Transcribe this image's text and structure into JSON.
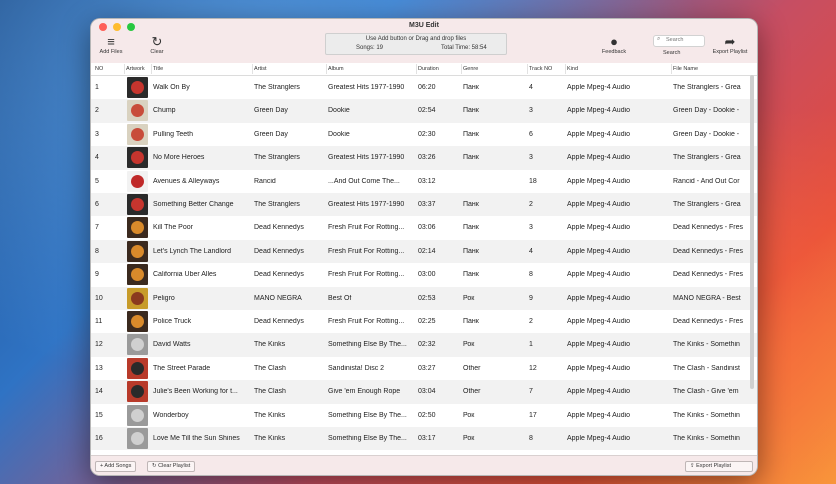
{
  "window": {
    "title": "M3U Edit"
  },
  "toolbar": {
    "add_files": "Add Files",
    "clear": "Clear",
    "drop_message": "Use Add button or Drag and drop files",
    "songs": "Songs: 19",
    "total_time": "Total Time: 58:54",
    "feedback": "Feedback",
    "search_placeholder": "Search",
    "search_label": "Search",
    "export": "Export Playlist"
  },
  "columns": [
    "NO",
    "Artwork",
    "Title",
    "Artist",
    "Album",
    "Duration",
    "Genre",
    "Track NO",
    "Kind",
    "File Name"
  ],
  "rows": [
    {
      "no": "1",
      "title": "Walk On By",
      "artist": "The Stranglers",
      "album": "Greatest Hits 1977-1990",
      "duration": "06:20",
      "genre": "Панк",
      "track": "4",
      "kind": "Apple Mpeg-4 Audio",
      "file": "The Stranglers - Grea"
    },
    {
      "no": "2",
      "title": "Chump",
      "artist": "Green Day",
      "album": "Dookie",
      "duration": "02:54",
      "genre": "Панк",
      "track": "3",
      "kind": "Apple Mpeg-4 Audio",
      "file": "Green Day - Dookie -"
    },
    {
      "no": "3",
      "title": "Pulling Teeth",
      "artist": "Green Day",
      "album": "Dookie",
      "duration": "02:30",
      "genre": "Панк",
      "track": "6",
      "kind": "Apple Mpeg-4 Audio",
      "file": "Green Day - Dookie -"
    },
    {
      "no": "4",
      "title": "No More Heroes",
      "artist": "The Stranglers",
      "album": "Greatest Hits 1977-1990",
      "duration": "03:26",
      "genre": "Панк",
      "track": "3",
      "kind": "Apple Mpeg-4 Audio",
      "file": "The Stranglers - Grea"
    },
    {
      "no": "5",
      "title": "Avenues & Alleyways",
      "artist": "Rancid",
      "album": "...And Out Come The...",
      "duration": "03:12",
      "genre": "",
      "track": "18",
      "kind": "Apple Mpeg-4 Audio",
      "file": "Rancid - And Out Cor"
    },
    {
      "no": "6",
      "title": "Something Better Change",
      "artist": "The Stranglers",
      "album": "Greatest Hits 1977-1990",
      "duration": "03:37",
      "genre": "Панк",
      "track": "2",
      "kind": "Apple Mpeg-4 Audio",
      "file": "The Stranglers - Grea"
    },
    {
      "no": "7",
      "title": "Kill The Poor",
      "artist": "Dead Kennedys",
      "album": "Fresh Fruit For Rotting...",
      "duration": "03:06",
      "genre": "Панк",
      "track": "3",
      "kind": "Apple Mpeg-4 Audio",
      "file": "Dead Kennedys - Fres"
    },
    {
      "no": "8",
      "title": "Let's Lynch The Landlord",
      "artist": "Dead Kennedys",
      "album": "Fresh Fruit For Rotting...",
      "duration": "02:14",
      "genre": "Панк",
      "track": "4",
      "kind": "Apple Mpeg-4 Audio",
      "file": "Dead Kennedys - Fres"
    },
    {
      "no": "9",
      "title": "California Uber Alles",
      "artist": "Dead Kennedys",
      "album": "Fresh Fruit For Rotting...",
      "duration": "03:00",
      "genre": "Панк",
      "track": "8",
      "kind": "Apple Mpeg-4 Audio",
      "file": "Dead Kennedys - Fres"
    },
    {
      "no": "10",
      "title": "Peligro",
      "artist": "MANO NEGRA",
      "album": "Best Of",
      "duration": "02:53",
      "genre": "Рок",
      "track": "9",
      "kind": "Apple Mpeg-4 Audio",
      "file": "MANO NEGRA - Best"
    },
    {
      "no": "11",
      "title": "Police Truck",
      "artist": "Dead Kennedys",
      "album": "Fresh Fruit For Rotting...",
      "duration": "02:25",
      "genre": "Панк",
      "track": "2",
      "kind": "Apple Mpeg-4 Audio",
      "file": "Dead Kennedys - Fres"
    },
    {
      "no": "12",
      "title": "David Watts",
      "artist": "The Kinks",
      "album": "Something Else By The...",
      "duration": "02:32",
      "genre": "Рок",
      "track": "1",
      "kind": "Apple Mpeg-4 Audio",
      "file": "The Kinks - Somethin"
    },
    {
      "no": "13",
      "title": "The Street Parade",
      "artist": "The Clash",
      "album": "Sandinista! Disc 2",
      "duration": "03:27",
      "genre": "Other",
      "track": "12",
      "kind": "Apple Mpeg-4 Audio",
      "file": "The Clash - Sandinist"
    },
    {
      "no": "14",
      "title": "Julie's Been Working for t...",
      "artist": "The Clash",
      "album": "Give 'em Enough Rope",
      "duration": "03:04",
      "genre": "Other",
      "track": "7",
      "kind": "Apple Mpeg-4 Audio",
      "file": "The Clash - Give 'em"
    },
    {
      "no": "15",
      "title": "Wonderboy",
      "artist": "The Kinks",
      "album": "Something Else By The...",
      "duration": "02:50",
      "genre": "Рок",
      "track": "17",
      "kind": "Apple Mpeg-4 Audio",
      "file": "The Kinks - Somethin"
    },
    {
      "no": "16",
      "title": "Love Me Till the Sun Shines",
      "artist": "The Kinks",
      "album": "Something Else By The...",
      "duration": "03:17",
      "genre": "Рок",
      "track": "8",
      "kind": "Apple Mpeg-4 Audio",
      "file": "The Kinks - Somethin"
    }
  ],
  "bottom": {
    "add_songs": "+ Add Songs",
    "clear_playlist": "Clear Playlist",
    "export": "Export Playlist"
  }
}
